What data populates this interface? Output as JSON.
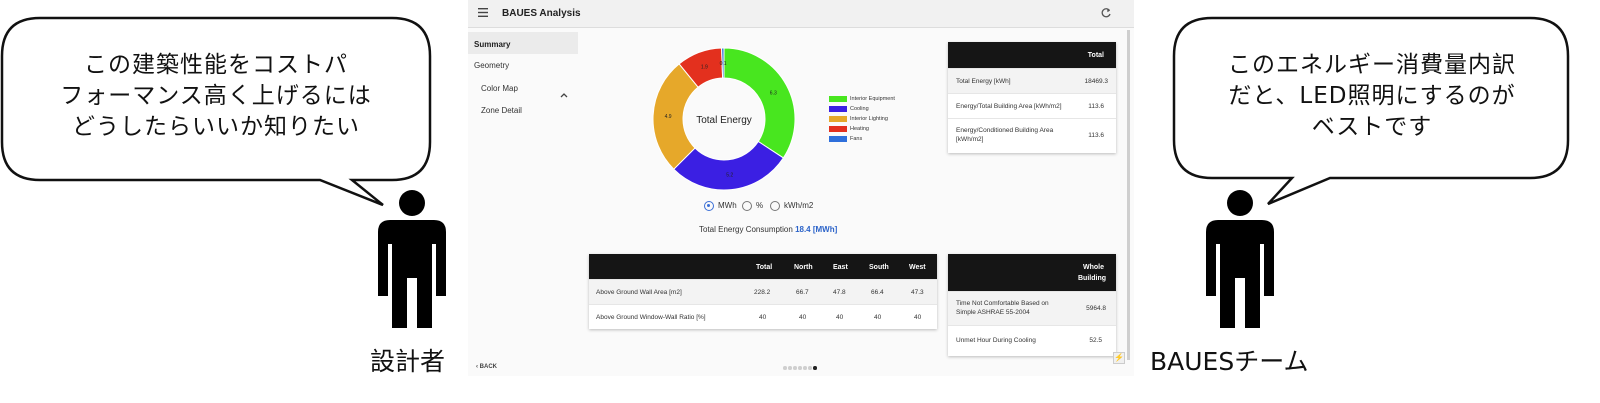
{
  "left_bubble": {
    "lines": [
      "この建築性能をコストパ",
      "フォーマンス高く上げるには",
      "どうしたらいいか知りたい"
    ]
  },
  "right_bubble": {
    "lines": [
      "このエネルギー消費量内訳",
      "だと、LED照明にするのが",
      "ベストです"
    ]
  },
  "left_person": {
    "label": "設計者"
  },
  "right_person": {
    "label": "BAUESチーム"
  },
  "app": {
    "title": "BAUES Analysis",
    "sidebar": {
      "items": [
        {
          "label": "Summary"
        },
        {
          "label": "Geometry"
        },
        {
          "label": "Color Map"
        },
        {
          "label": "Zone Detail"
        }
      ]
    },
    "donut": {
      "center_label": "Total Energy",
      "slices": [
        {
          "name": "Interior Equipment",
          "value": 6.3,
          "label": "6.3",
          "color": "#48e61f"
        },
        {
          "name": "Cooling",
          "value": 5.2,
          "label": "5.2",
          "color": "#3b1fe3"
        },
        {
          "name": "Interior Lighting",
          "value": 4.9,
          "label": "4.9",
          "color": "#e6a82a"
        },
        {
          "name": "Heating",
          "value": 1.9,
          "label": "1.9",
          "color": "#e3301e"
        },
        {
          "name": "Fans",
          "value": 0.1,
          "label": "0.1",
          "color": "#2e6fdb"
        }
      ]
    },
    "radio": {
      "options": [
        "MWh",
        "%",
        "kWh/m2"
      ],
      "selected": "MWh"
    },
    "consumption": {
      "label": "Total Energy Consumption",
      "value": "18.4 [MWh]"
    },
    "total_table": {
      "header": "Total",
      "rows": [
        {
          "label": "Total Energy [kWh]",
          "value": "18469.3"
        },
        {
          "label": "Energy/Total Building Area [kWh/m2]",
          "value": "113.6"
        },
        {
          "label_lines": [
            "Energy/Conditioned Building Area",
            "[kWh/m2]"
          ],
          "value": "113.6"
        }
      ]
    },
    "wall_table": {
      "headers": [
        "Total",
        "North",
        "East",
        "South",
        "West"
      ],
      "rows": [
        {
          "label": "Above Ground Wall Area [m2]",
          "values": [
            "228.2",
            "66.7",
            "47.8",
            "66.4",
            "47.3"
          ]
        },
        {
          "label": "Above Ground Window-Wall Ratio [%]",
          "values": [
            "40",
            "40",
            "40",
            "40",
            "40"
          ]
        }
      ]
    },
    "comfort_table": {
      "header_lines": [
        "Whole",
        "Building"
      ],
      "rows": [
        {
          "label_lines": [
            "Time Not Comfortable Based on",
            "Simple ASHRAE 55-2004"
          ],
          "value": "5964.8"
        },
        {
          "label": "Unmet Hour During Cooling",
          "value": "52.5"
        }
      ]
    },
    "back_label": "BACK",
    "pagination": {
      "count": 7,
      "active": 7
    }
  }
}
